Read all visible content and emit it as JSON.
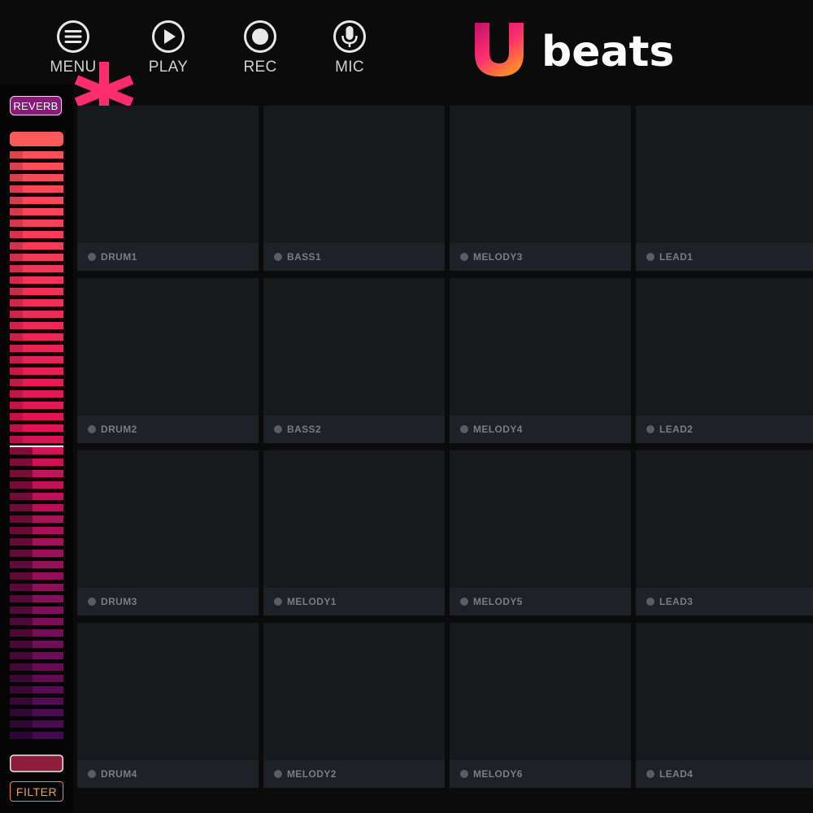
{
  "toolbar": {
    "menu_label": "MENU",
    "play_label": "PLAY",
    "rec_label": "REC",
    "mic_label": "MIC"
  },
  "logo": {
    "text": "beats",
    "letter": "U"
  },
  "side": {
    "reverb_label": "REVERB",
    "filter_label": "FILTER",
    "meter_marker_level": 0.5
  },
  "colors": {
    "accent_pink": "#ff2d6e",
    "reverb_purple": "#8a1a7a",
    "filter_orange": "#f08a2a"
  },
  "pads": [
    [
      "DRUM1",
      "BASS1",
      "MELODY3",
      "LEAD1"
    ],
    [
      "DRUM2",
      "BASS2",
      "MELODY4",
      "LEAD2"
    ],
    [
      "DRUM3",
      "MELODY1",
      "MELODY5",
      "LEAD3"
    ],
    [
      "DRUM4",
      "MELODY2",
      "MELODY6",
      "LEAD4"
    ]
  ]
}
